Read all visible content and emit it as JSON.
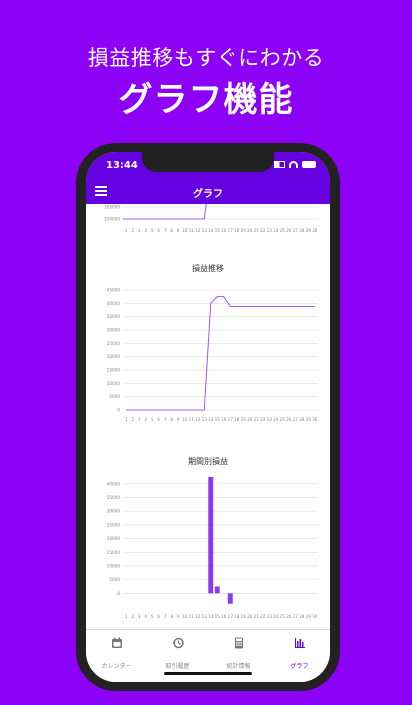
{
  "promo": {
    "subtitle": "損益推移もすぐにわかる",
    "title": "グラフ機能"
  },
  "status": {
    "time": "13:44"
  },
  "nav": {
    "title": "グラフ"
  },
  "colors": {
    "accent": "#6500e0",
    "background": "#8c00f5",
    "series": "#9b5cf0"
  },
  "chart_data": [
    {
      "type": "line",
      "title": "",
      "x": [
        "1",
        "2",
        "3",
        "4",
        "5",
        "6",
        "7",
        "8",
        "9",
        "10",
        "11",
        "12",
        "13",
        "14",
        "15",
        "16",
        "17",
        "18",
        "19",
        "20",
        "21",
        "22",
        "23",
        "24",
        "25",
        "26",
        "27",
        "28",
        "29",
        "30"
      ],
      "y_ticks": [
        "355000",
        "350000"
      ],
      "note": "partially visible chart at top"
    },
    {
      "type": "line",
      "title": "損益推移",
      "x": [
        "1",
        "2",
        "3",
        "4",
        "5",
        "6",
        "7",
        "8",
        "9",
        "10",
        "11",
        "12",
        "13",
        "14",
        "15",
        "16",
        "17",
        "18",
        "19",
        "20",
        "21",
        "22",
        "23",
        "24",
        "25",
        "26",
        "27",
        "28",
        "29",
        "30"
      ],
      "y_ticks": [
        "45000",
        "40000",
        "35000",
        "30000",
        "25000",
        "20000",
        "15000",
        "10000",
        "5000",
        "0"
      ],
      "ylim": [
        0,
        45000
      ],
      "values": [
        0,
        0,
        0,
        0,
        0,
        0,
        0,
        0,
        0,
        0,
        0,
        0,
        0,
        40000,
        42500,
        42500,
        38800,
        38800,
        38800,
        38800,
        38800,
        38800,
        38800,
        38800,
        38800,
        38800,
        38800,
        38800,
        38800,
        38800
      ]
    },
    {
      "type": "bar",
      "title": "期間別損益",
      "x": [
        "1",
        "2",
        "3",
        "4",
        "5",
        "6",
        "7",
        "8",
        "9",
        "10",
        "11",
        "12",
        "13",
        "14",
        "15",
        "16",
        "17",
        "18",
        "19",
        "20",
        "21",
        "22",
        "23",
        "24",
        "25",
        "26",
        "27",
        "28",
        "29",
        "30"
      ],
      "y_ticks": [
        "40000",
        "35000",
        "30000",
        "25000",
        "20000",
        "15000",
        "10000",
        "5000",
        "0"
      ],
      "ylim": [
        -5000,
        42500
      ],
      "values": [
        0,
        0,
        0,
        0,
        0,
        0,
        0,
        0,
        0,
        0,
        0,
        0,
        0,
        42500,
        2500,
        0,
        -3800,
        0,
        0,
        0,
        0,
        0,
        0,
        0,
        0,
        0,
        0,
        0,
        0,
        0
      ]
    }
  ],
  "tabs": [
    {
      "label": "カレンダー",
      "icon": "calendar-icon"
    },
    {
      "label": "取引履歴",
      "icon": "history-icon"
    },
    {
      "label": "統計情報",
      "icon": "calculator-icon"
    },
    {
      "label": "グラフ",
      "icon": "bar-chart-icon"
    }
  ]
}
